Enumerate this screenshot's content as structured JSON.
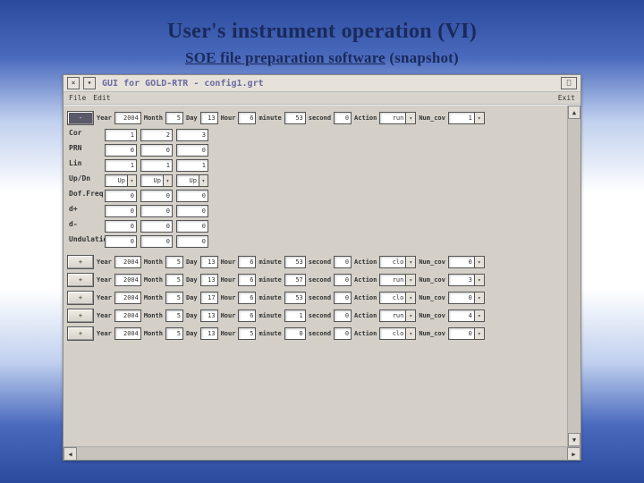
{
  "slide": {
    "title": "User's instrument operation (VI)",
    "sub_ul": "SOE file preparation software",
    "sub_tail": " (snapshot)"
  },
  "win": {
    "close": "×",
    "min": "▾",
    "title": "GUI for GOLD-RTR - config1.grt",
    "help": "⎕"
  },
  "menu": {
    "file": "File",
    "edit": "Edit",
    "exit": "Exit"
  },
  "hdr": {
    "expand": "-",
    "collapse": "+",
    "year": "Year",
    "month": "Month",
    "day": "Day",
    "hour": "Hour",
    "minute": "minute",
    "second": "second",
    "action": "Action",
    "numcov": "Num_cov"
  },
  "rows": [
    {
      "plus": "-",
      "dark": true,
      "year": "2004",
      "month": "5",
      "day": "13",
      "hour": "6",
      "minute": "53",
      "second": "0",
      "action": "run",
      "cov": "1"
    },
    {
      "plus": "+",
      "year": "2004",
      "month": "5",
      "day": "13",
      "hour": "6",
      "minute": "53",
      "second": "0",
      "action": "clo",
      "cov": "0"
    },
    {
      "plus": "+",
      "year": "2004",
      "month": "5",
      "day": "13",
      "hour": "6",
      "minute": "57",
      "second": "0",
      "action": "run",
      "cov": "3"
    },
    {
      "plus": "+",
      "year": "2004",
      "month": "5",
      "day": "17",
      "hour": "6",
      "minute": "53",
      "second": "0",
      "action": "clo",
      "cov": "0"
    },
    {
      "plus": "+",
      "year": "2004",
      "month": "5",
      "day": "13",
      "hour": "6",
      "minute": "1",
      "second": "0",
      "action": "run",
      "cov": "4"
    },
    {
      "plus": "+",
      "year": "2004",
      "month": "5",
      "day": "13",
      "hour": "5",
      "minute": "0",
      "second": "0",
      "action": "clo",
      "cov": "0"
    }
  ],
  "grid": {
    "labels": {
      "cor": "Cor",
      "prn": "PRN",
      "lin": "Lin",
      "updn": "Up/Dn",
      "doffreq": "Dof.Freq.",
      "dp": "d+",
      "dm": "d-",
      "undulation": "Undulation"
    },
    "c": {
      "cor": [
        "1",
        "2",
        "3"
      ],
      "prn": [
        "0",
        "0",
        "0"
      ],
      "lin": [
        "1",
        "1",
        "1"
      ],
      "updn": [
        "Up",
        "Up",
        "Up"
      ],
      "doffreq": [
        "0",
        "0",
        "0"
      ],
      "dp": [
        "0",
        "0",
        "0"
      ],
      "dm": [
        "0",
        "0",
        "0"
      ],
      "und": [
        "0",
        "0",
        "0"
      ]
    }
  }
}
